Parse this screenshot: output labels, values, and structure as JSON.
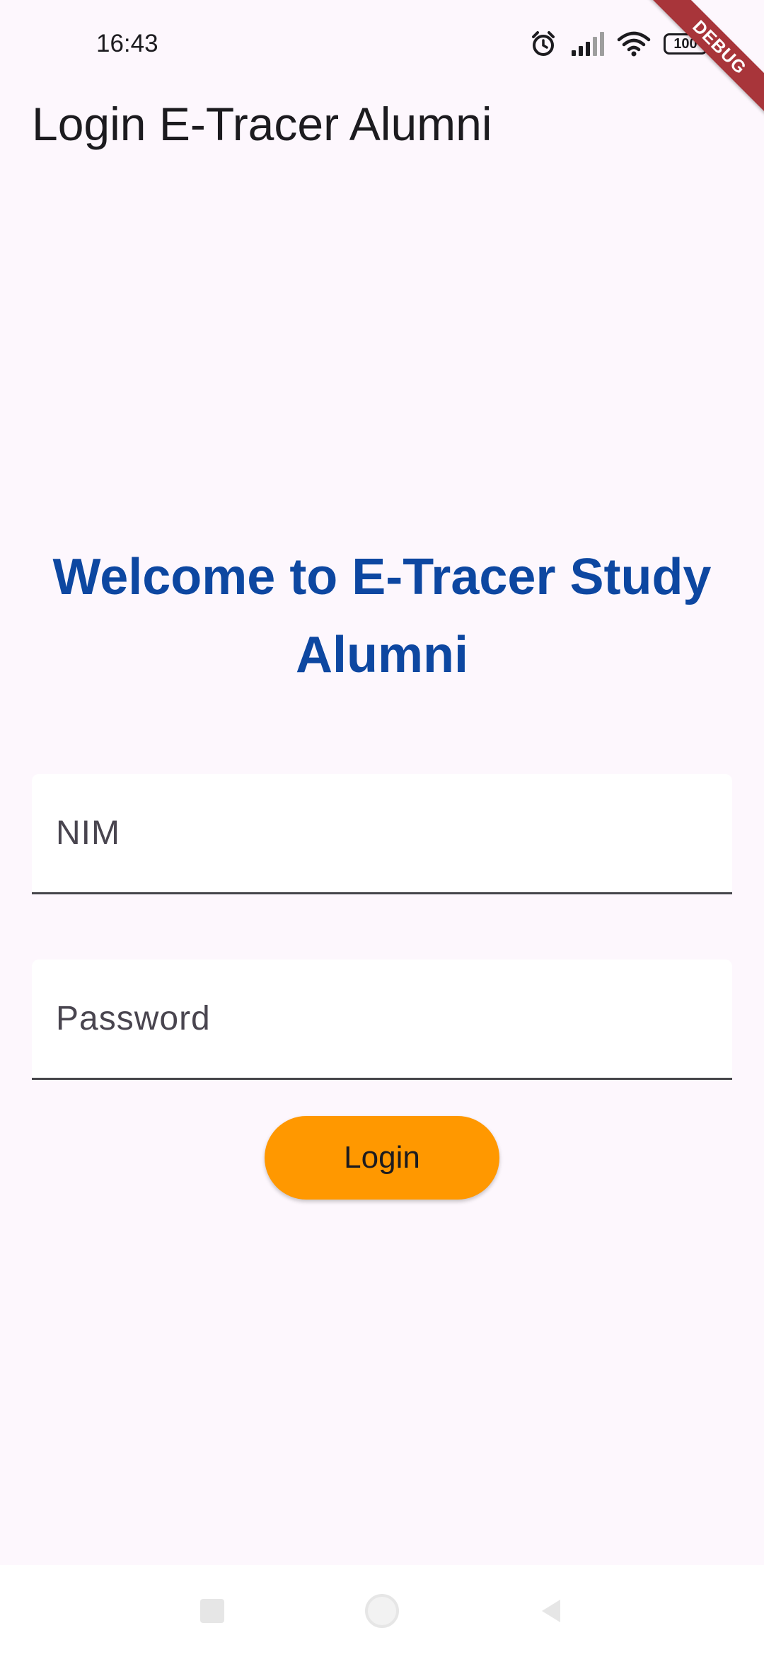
{
  "status_bar": {
    "time": "16:43",
    "battery_level": "100",
    "icons": [
      "alarm-icon",
      "signal-icon",
      "wifi-icon",
      "battery-icon"
    ]
  },
  "debug_banner": "DEBUG",
  "app_bar": {
    "title": "Login E-Tracer Alumni"
  },
  "welcome_title": "Welcome to E-Tracer Study Alumni",
  "form": {
    "nim": {
      "placeholder": "NIM",
      "value": ""
    },
    "password": {
      "placeholder": "Password",
      "value": ""
    },
    "login_label": "Login"
  },
  "colors": {
    "background": "#FDF7FD",
    "heading": "#0D47A1",
    "button": "#FF9800",
    "debug_ribbon": "#A8353A"
  },
  "nav_bar": {
    "buttons": [
      "recent-apps-icon",
      "home-icon",
      "back-icon"
    ]
  }
}
